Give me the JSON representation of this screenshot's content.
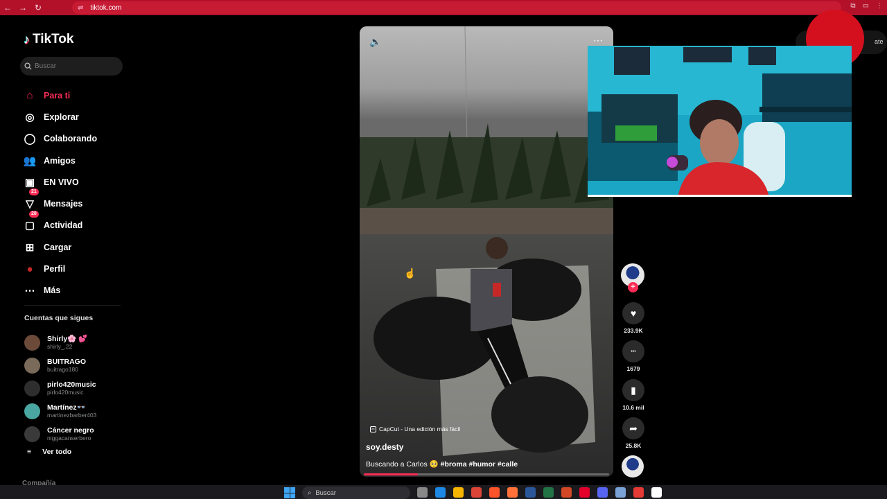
{
  "browser": {
    "url": "tiktok.com",
    "nav": [
      {
        "name": "back-icon",
        "glyph": "←"
      },
      {
        "name": "forward-icon",
        "glyph": "→"
      },
      {
        "name": "reload-icon",
        "glyph": "↻"
      }
    ],
    "tune_icon": "⇌",
    "right_icons": [
      "⧉",
      "▭",
      "⋮"
    ]
  },
  "sidebar": {
    "logo": "TikTok",
    "logo_icon": "♪",
    "search_placeholder": "Buscar",
    "nav": [
      {
        "key": "for-you",
        "label": "Para ti",
        "icon": "⌂",
        "badge": "",
        "active": true
      },
      {
        "key": "explore",
        "label": "Explorar",
        "icon": "◎",
        "badge": ""
      },
      {
        "key": "collab",
        "label": "Colaborando",
        "icon": "◯",
        "badge": ""
      },
      {
        "key": "friends",
        "label": "Amigos",
        "icon": "👥",
        "badge": ""
      },
      {
        "key": "live",
        "label": "EN VIVO",
        "icon": "▣",
        "badge": ""
      },
      {
        "key": "messages",
        "label": "Mensajes",
        "icon": "▽",
        "badge": "21"
      },
      {
        "key": "activity",
        "label": "Actividad",
        "icon": "▢",
        "badge": "20"
      },
      {
        "key": "upload",
        "label": "Cargar",
        "icon": "⊞",
        "badge": ""
      },
      {
        "key": "profile",
        "label": "Perfil",
        "icon": "●",
        "badge": ""
      },
      {
        "key": "more",
        "label": "Más",
        "icon": "⋯",
        "badge": ""
      }
    ],
    "following_title": "Cuentas que sigues",
    "following": [
      {
        "name": "Shirly🌸 💕",
        "user": "shirly_.22",
        "color": "#6b4a3a"
      },
      {
        "name": "BUITRAGO",
        "user": "buitrago180",
        "color": "#7a6a5a"
      },
      {
        "name": "pirlo420music",
        "user": "pirlo420music",
        "color": "#2e2e2e"
      },
      {
        "name": "Martínez👓",
        "user": "martinezbarber403",
        "color": "#4aa6a0"
      },
      {
        "name": "Cáncer negro",
        "user": "niggacanserbero",
        "color": "#3a3a3a"
      }
    ],
    "see_all_icon": "≡",
    "see_all": "Ver todo",
    "company": "Compañía"
  },
  "video": {
    "volume_icon": "🔈",
    "more_icon": "⋯",
    "capcut": "CapCut - Una edición más fácil",
    "author": "soy.desty",
    "description": "Buscando a Carlos 🥺",
    "tags": "#broma #humor #calle",
    "progress_fraction": 0.22
  },
  "actions": {
    "plus": "+",
    "like_icon": "♥",
    "likes": "233.9K",
    "comment_icon": "•••",
    "comments": "1679",
    "save_icon": "▮",
    "saves": "10.6 mil",
    "share_icon": "➦",
    "shares": "25.8K"
  },
  "overlay_right_text": "ate",
  "taskbar": {
    "search": "Buscar",
    "search_icon": "⌕",
    "apps": [
      "#888888",
      "#1e88e5",
      "#f4b400",
      "#db4437",
      "#fb542b",
      "#ff7139",
      "#2b579a",
      "#217346",
      "#d24726",
      "#e4002b",
      "#5865f2",
      "#7aa2d6",
      "#e53935",
      "#ffffff"
    ]
  }
}
